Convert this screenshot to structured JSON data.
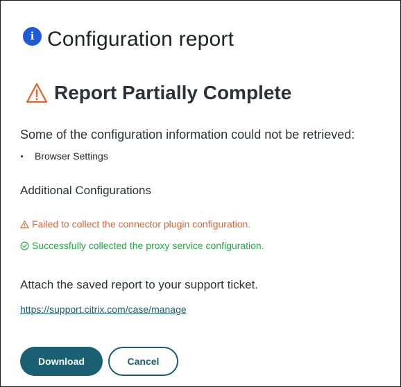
{
  "dialog": {
    "title": "Configuration report",
    "info_icon_glyph": "i",
    "status_title": "Report Partially Complete",
    "description": "Some of the configuration information could not be retrieved:",
    "missing_items": [
      "Browser Settings"
    ],
    "section_title": "Additional Configurations",
    "failure_message": "Failed to collect the connector plugin configuration.",
    "success_message": "Successfully collected the proxy service configuration.",
    "attach_text": "Attach the saved report to your support ticket.",
    "support_link": "https://support.citrix.com/case/manage",
    "download_label": "Download",
    "cancel_label": "Cancel"
  },
  "icons": {
    "info": "info-icon",
    "status_warning": "warning-triangle-icon",
    "failure": "warning-triangle-icon",
    "success": "check-circle-icon"
  },
  "colors": {
    "info_blue": "#1e5bd6",
    "warning_orange": "#e8602c",
    "success_green": "#1fae3e",
    "primary_teal": "#1b5f73"
  }
}
